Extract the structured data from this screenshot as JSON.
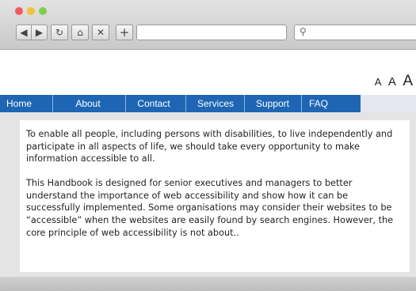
{
  "browser": {
    "toolbar": {
      "back_icon": "◀",
      "forward_icon": "▶",
      "reload_icon": "↻",
      "home_icon": "⌂",
      "stop_icon": "✕",
      "newtab_icon": "+",
      "search_icon": "⚲"
    },
    "url": "",
    "search": ""
  },
  "text_size": [
    "A",
    "A",
    "A"
  ],
  "nav": {
    "items": [
      {
        "label": "Home"
      },
      {
        "label": "About"
      },
      {
        "label": "Contact"
      },
      {
        "label": "Services"
      },
      {
        "label": "Support"
      },
      {
        "label": "FAQ"
      }
    ]
  },
  "content": {
    "paragraphs": [
      "To enable all people, including persons with disabilities, to live independently and participate in all aspects of life, we should take every opportunity to make information accessible to all.",
      "This Handbook is designed for senior executives and managers to better understand the importance of web accessibility and show how it can be successfully implemented. Some organisations may consider their websites to be “accessible” when the websites are easily found by search engines. However, the core principle of web accessibility is not about.."
    ]
  },
  "colors": {
    "menu_blue": "#1e66b4",
    "menu_lavender": "#e6e6f0"
  }
}
